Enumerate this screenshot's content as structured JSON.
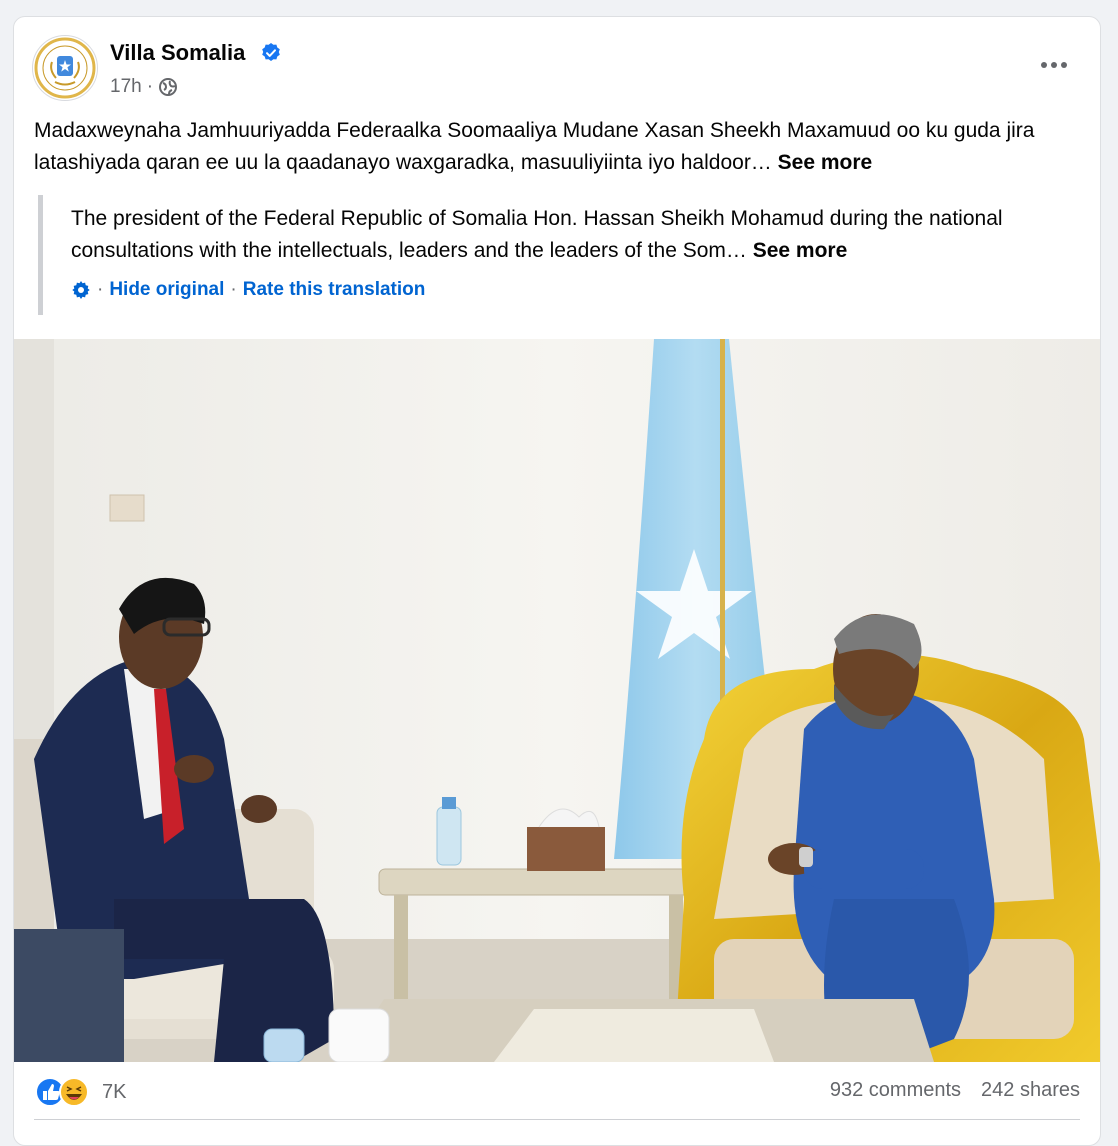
{
  "post": {
    "page_name": "Villa Somalia",
    "time": "17h",
    "privacy_icon": "globe-icon",
    "verified_icon": "verified-badge-icon",
    "text": "Madaxweynaha Jamhuuriyadda Federaalka Soomaaliya Mudane Xasan Sheekh Maxamuud oo ku guda jira latashiyada qaran ee uu la qaadanayo waxgaradka, masuuliyiinta iyo haldoor…",
    "see_more": "See more",
    "translation": {
      "text": "The president of the Federal Republic of Somalia Hon. Hassan Sheikh Mohamud during the national consultations with the intellectuals, leaders and the leaders of the Som…",
      "see_more": "See more",
      "hide_original": "Hide original",
      "rate_translation": "Rate this translation"
    }
  },
  "reactions": {
    "count": "7K",
    "types": [
      "like",
      "haha"
    ]
  },
  "stats": {
    "comments": "932 comments",
    "shares": "242 shares"
  },
  "colors": {
    "link_blue": "#0064d1",
    "verified_blue": "#1877f2",
    "secondary_text": "#65676b"
  }
}
